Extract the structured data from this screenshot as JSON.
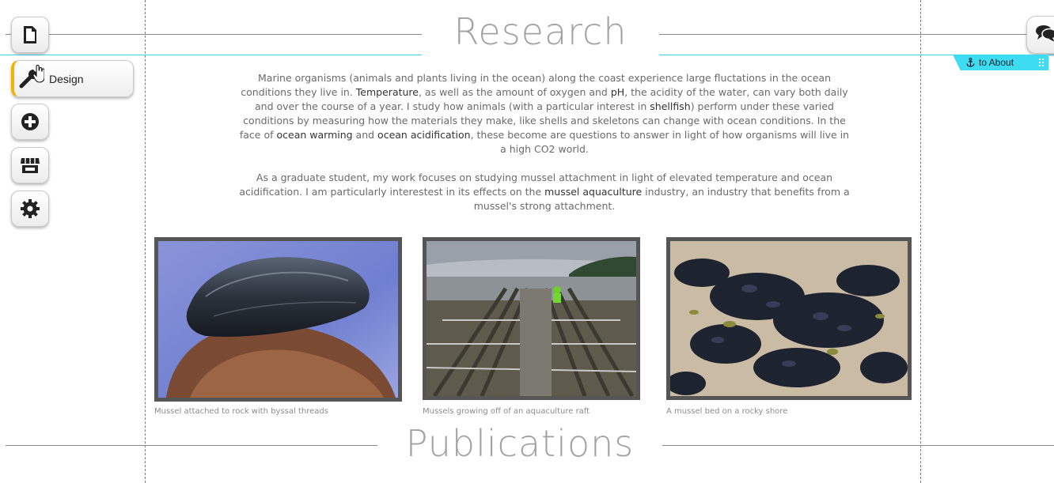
{
  "sections": {
    "research_title": "Research",
    "publications_title": "Publications"
  },
  "toolbar": {
    "design_label": "Design",
    "icons": [
      "page-icon",
      "design-wrench-icon",
      "add-icon",
      "store-icon",
      "gear-icon",
      "chat-icon"
    ]
  },
  "anchor": {
    "label": "to About"
  },
  "research": {
    "p1": [
      {
        "t": "Marine organisms (animals and plants living in the ocean) along the coast experience large fluctations in the ocean conditions they live in. "
      },
      {
        "t": "Temperature",
        "b": true
      },
      {
        "t": ", as well as the amount of oxygen and "
      },
      {
        "t": "pH",
        "b": true
      },
      {
        "t": ", the acidity of the water, can vary both daily and over the course of a year.  I study how animals (with a particular interest in "
      },
      {
        "t": "shellfish",
        "b": true
      },
      {
        "t": ") perform under these varied conditions by measuring how the materials they make, like shells and skeletons can change with ocean conditions. In the face of "
      },
      {
        "t": "ocean warming",
        "b": true
      },
      {
        "t": " and "
      },
      {
        "t": "ocean acidification",
        "b": true
      },
      {
        "t": ", these become are questions to answer in light of how organisms will live in a high CO2 world."
      }
    ],
    "p2": [
      {
        "t": "As a graduate student, my work focuses on studying mussel attachment in light of elevated temperature and ocean acidification. I am particularly interestest in its effects on the "
      },
      {
        "t": "mussel aquaculture",
        "b": true
      },
      {
        "t": " industry, an industry that benefits from a mussel's strong attachment."
      }
    ]
  },
  "gallery": [
    {
      "caption": "Mussel attached to rock with byssal threads"
    },
    {
      "caption": "Mussels growing off of an aquaculture raft"
    },
    {
      "caption": "A mussel bed on a rocky shore"
    }
  ],
  "colors": {
    "accent_cyan": "#39d3ea",
    "design_accent": "#f2b400",
    "photo_border": "#555555"
  }
}
